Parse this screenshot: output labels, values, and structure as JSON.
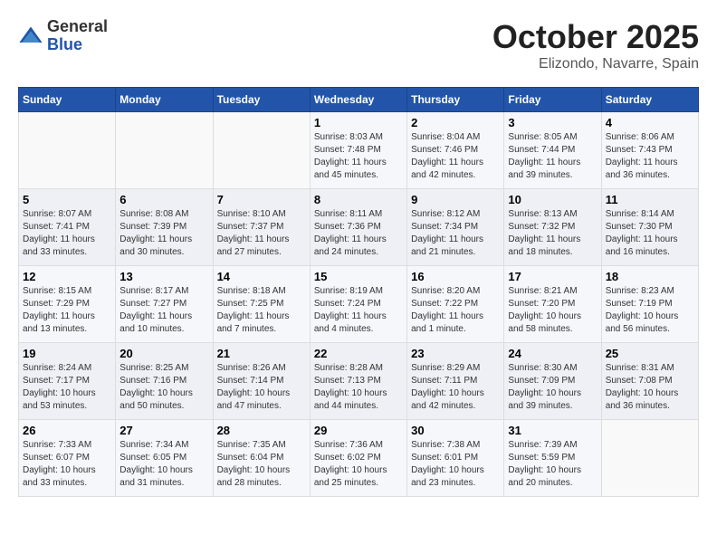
{
  "header": {
    "logo_general": "General",
    "logo_blue": "Blue",
    "month": "October 2025",
    "location": "Elizondo, Navarre, Spain"
  },
  "weekdays": [
    "Sunday",
    "Monday",
    "Tuesday",
    "Wednesday",
    "Thursday",
    "Friday",
    "Saturday"
  ],
  "weeks": [
    [
      {
        "day": "",
        "text": ""
      },
      {
        "day": "",
        "text": ""
      },
      {
        "day": "",
        "text": ""
      },
      {
        "day": "1",
        "text": "Sunrise: 8:03 AM\nSunset: 7:48 PM\nDaylight: 11 hours and 45 minutes."
      },
      {
        "day": "2",
        "text": "Sunrise: 8:04 AM\nSunset: 7:46 PM\nDaylight: 11 hours and 42 minutes."
      },
      {
        "day": "3",
        "text": "Sunrise: 8:05 AM\nSunset: 7:44 PM\nDaylight: 11 hours and 39 minutes."
      },
      {
        "day": "4",
        "text": "Sunrise: 8:06 AM\nSunset: 7:43 PM\nDaylight: 11 hours and 36 minutes."
      }
    ],
    [
      {
        "day": "5",
        "text": "Sunrise: 8:07 AM\nSunset: 7:41 PM\nDaylight: 11 hours and 33 minutes."
      },
      {
        "day": "6",
        "text": "Sunrise: 8:08 AM\nSunset: 7:39 PM\nDaylight: 11 hours and 30 minutes."
      },
      {
        "day": "7",
        "text": "Sunrise: 8:10 AM\nSunset: 7:37 PM\nDaylight: 11 hours and 27 minutes."
      },
      {
        "day": "8",
        "text": "Sunrise: 8:11 AM\nSunset: 7:36 PM\nDaylight: 11 hours and 24 minutes."
      },
      {
        "day": "9",
        "text": "Sunrise: 8:12 AM\nSunset: 7:34 PM\nDaylight: 11 hours and 21 minutes."
      },
      {
        "day": "10",
        "text": "Sunrise: 8:13 AM\nSunset: 7:32 PM\nDaylight: 11 hours and 18 minutes."
      },
      {
        "day": "11",
        "text": "Sunrise: 8:14 AM\nSunset: 7:30 PM\nDaylight: 11 hours and 16 minutes."
      }
    ],
    [
      {
        "day": "12",
        "text": "Sunrise: 8:15 AM\nSunset: 7:29 PM\nDaylight: 11 hours and 13 minutes."
      },
      {
        "day": "13",
        "text": "Sunrise: 8:17 AM\nSunset: 7:27 PM\nDaylight: 11 hours and 10 minutes."
      },
      {
        "day": "14",
        "text": "Sunrise: 8:18 AM\nSunset: 7:25 PM\nDaylight: 11 hours and 7 minutes."
      },
      {
        "day": "15",
        "text": "Sunrise: 8:19 AM\nSunset: 7:24 PM\nDaylight: 11 hours and 4 minutes."
      },
      {
        "day": "16",
        "text": "Sunrise: 8:20 AM\nSunset: 7:22 PM\nDaylight: 11 hours and 1 minute."
      },
      {
        "day": "17",
        "text": "Sunrise: 8:21 AM\nSunset: 7:20 PM\nDaylight: 10 hours and 58 minutes."
      },
      {
        "day": "18",
        "text": "Sunrise: 8:23 AM\nSunset: 7:19 PM\nDaylight: 10 hours and 56 minutes."
      }
    ],
    [
      {
        "day": "19",
        "text": "Sunrise: 8:24 AM\nSunset: 7:17 PM\nDaylight: 10 hours and 53 minutes."
      },
      {
        "day": "20",
        "text": "Sunrise: 8:25 AM\nSunset: 7:16 PM\nDaylight: 10 hours and 50 minutes."
      },
      {
        "day": "21",
        "text": "Sunrise: 8:26 AM\nSunset: 7:14 PM\nDaylight: 10 hours and 47 minutes."
      },
      {
        "day": "22",
        "text": "Sunrise: 8:28 AM\nSunset: 7:13 PM\nDaylight: 10 hours and 44 minutes."
      },
      {
        "day": "23",
        "text": "Sunrise: 8:29 AM\nSunset: 7:11 PM\nDaylight: 10 hours and 42 minutes."
      },
      {
        "day": "24",
        "text": "Sunrise: 8:30 AM\nSunset: 7:09 PM\nDaylight: 10 hours and 39 minutes."
      },
      {
        "day": "25",
        "text": "Sunrise: 8:31 AM\nSunset: 7:08 PM\nDaylight: 10 hours and 36 minutes."
      }
    ],
    [
      {
        "day": "26",
        "text": "Sunrise: 7:33 AM\nSunset: 6:07 PM\nDaylight: 10 hours and 33 minutes."
      },
      {
        "day": "27",
        "text": "Sunrise: 7:34 AM\nSunset: 6:05 PM\nDaylight: 10 hours and 31 minutes."
      },
      {
        "day": "28",
        "text": "Sunrise: 7:35 AM\nSunset: 6:04 PM\nDaylight: 10 hours and 28 minutes."
      },
      {
        "day": "29",
        "text": "Sunrise: 7:36 AM\nSunset: 6:02 PM\nDaylight: 10 hours and 25 minutes."
      },
      {
        "day": "30",
        "text": "Sunrise: 7:38 AM\nSunset: 6:01 PM\nDaylight: 10 hours and 23 minutes."
      },
      {
        "day": "31",
        "text": "Sunrise: 7:39 AM\nSunset: 5:59 PM\nDaylight: 10 hours and 20 minutes."
      },
      {
        "day": "",
        "text": ""
      }
    ]
  ]
}
